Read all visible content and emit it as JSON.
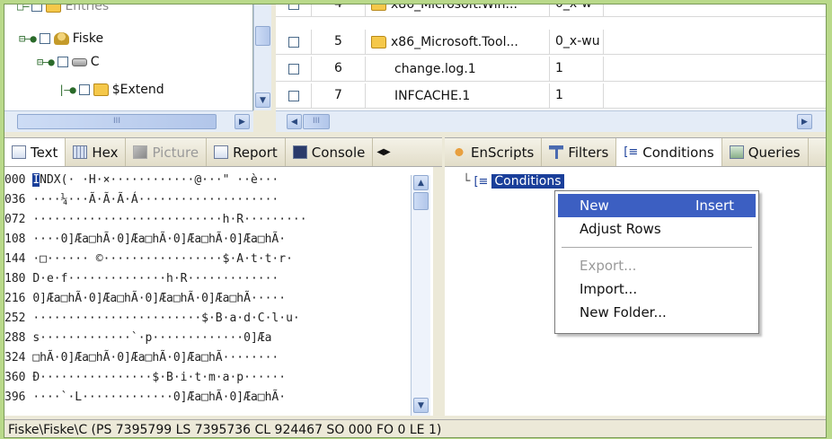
{
  "tree": {
    "items": [
      {
        "label": "Entries",
        "icon": "folder-icon"
      },
      {
        "label": "Fiske",
        "icon": "user-icon"
      },
      {
        "label": "C",
        "icon": "drive-icon"
      },
      {
        "label": "$Extend",
        "icon": "folder-icon"
      }
    ],
    "hscroll_grip": "III"
  },
  "table": {
    "rows": [
      {
        "index": "4",
        "name": "x86_Microsoft.Win...",
        "ext": "0_x-w",
        "folder": true
      },
      {
        "index": "5",
        "name": "x86_Microsoft.Tool...",
        "ext": "0_x-wu",
        "folder": true
      },
      {
        "index": "6",
        "name": "change.log.1",
        "ext": "1",
        "folder": false
      },
      {
        "index": "7",
        "name": "INFCACHE.1",
        "ext": "1",
        "folder": false
      }
    ],
    "hscroll_grip": "III"
  },
  "left_tabs": [
    {
      "label": "Text",
      "icon": "text-icon",
      "state": "active"
    },
    {
      "label": "Hex",
      "icon": "hex-grid-icon",
      "state": "normal"
    },
    {
      "label": "Picture",
      "icon": "picture-icon",
      "state": "disabled"
    },
    {
      "label": "Report",
      "icon": "report-icon",
      "state": "normal"
    },
    {
      "label": "Console",
      "icon": "console-icon",
      "state": "normal"
    }
  ],
  "hex_lines": [
    {
      "offset": "000",
      "text": "NDX(· ·H·×············@···\" ··è···",
      "cursor": "I"
    },
    {
      "offset": "036",
      "text": "····¼···Ã·Ã·Ã·Á····················",
      "cursor": ""
    },
    {
      "offset": "072",
      "text": "···························h·R·········",
      "cursor": ""
    },
    {
      "offset": "108",
      "text": "····0]Æa□hÃ·0]Æa□hÃ·0]Æa□hÃ·0]Æa□hÃ·",
      "cursor": ""
    },
    {
      "offset": "144",
      "text": "·□······ ©·················$·A·t·t·r·",
      "cursor": ""
    },
    {
      "offset": "180",
      "text": "D·e·f··············h·R·············",
      "cursor": ""
    },
    {
      "offset": "216",
      "text": "0]Æa□hÃ·0]Æa□hÃ·0]Æa□hÃ·0]Æa□hÃ·····",
      "cursor": ""
    },
    {
      "offset": "252",
      "text": "························$·B·a·d·C·l·u·",
      "cursor": ""
    },
    {
      "offset": "288",
      "text": "s·············`·p·············0]Æa",
      "cursor": ""
    },
    {
      "offset": "324",
      "text": "□hÃ·0]Æa□hÃ·0]Æa□hÃ·0]Æa□hÃ········",
      "cursor": ""
    },
    {
      "offset": "360",
      "text": "Ð················$·B·i·t·m·a·p······",
      "cursor": ""
    },
    {
      "offset": "396",
      "text": "····`·L·············0]Æa□hÃ·0]Æa□hÃ·",
      "cursor": ""
    }
  ],
  "right_tabs": [
    {
      "label": "EnScripts",
      "icon": "enscripts-icon",
      "state": "normal"
    },
    {
      "label": "Filters",
      "icon": "filter-icon",
      "state": "normal"
    },
    {
      "label": "Conditions",
      "icon": "conditions-icon",
      "state": "active"
    },
    {
      "label": "Queries",
      "icon": "queries-icon",
      "state": "normal"
    }
  ],
  "conditions_tree": {
    "root_label": "Conditions"
  },
  "context_menu": {
    "items": [
      {
        "label": "New",
        "shortcut": "Insert",
        "state": "highlighted"
      },
      {
        "label": "Adjust Rows",
        "shortcut": "",
        "state": "normal"
      },
      {
        "label": "Export...",
        "shortcut": "",
        "state": "disabled"
      },
      {
        "label": "Import...",
        "shortcut": "",
        "state": "normal"
      },
      {
        "label": "New Folder...",
        "shortcut": "",
        "state": "normal"
      }
    ]
  },
  "status_bar": {
    "text": "Fiske\\Fiske\\C (PS 7395799 LS 7395736 CL 924467 SO 000 FO 0 LE 1)"
  },
  "colors": {
    "selection": "#1a3f9a",
    "menu_highlight": "#3c5fc2",
    "border_green": "#b9d98a"
  }
}
